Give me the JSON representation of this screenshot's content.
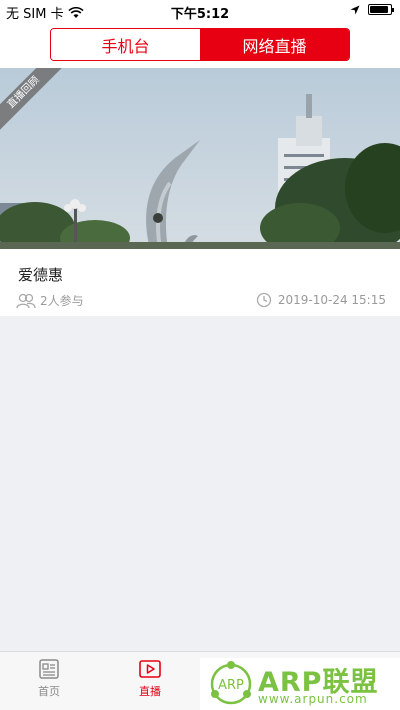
{
  "status_bar": {
    "carrier": "无 SIM 卡",
    "time": "下午5:12",
    "battery_level": 0.9
  },
  "header": {
    "segments": [
      {
        "label": "手机台",
        "active": false
      },
      {
        "label": "网络直播",
        "active": true
      }
    ]
  },
  "live_list": [
    {
      "ribbon": "直播回顾",
      "title": "爱德惠",
      "participants": "2人参与",
      "datetime": "2019-10-24 15:15"
    }
  ],
  "tab_bar": {
    "tabs": [
      {
        "label": "首页",
        "icon": "news-icon",
        "active": false
      },
      {
        "label": "直播",
        "icon": "play-video-icon",
        "active": true
      }
    ]
  },
  "watermark": {
    "logo_text": "ARP",
    "brand": "ARP联盟",
    "url": "www.arpun.com"
  },
  "colors": {
    "accent": "#e60012",
    "background": "#eef0f3",
    "watermark_green": "#7cc242"
  }
}
